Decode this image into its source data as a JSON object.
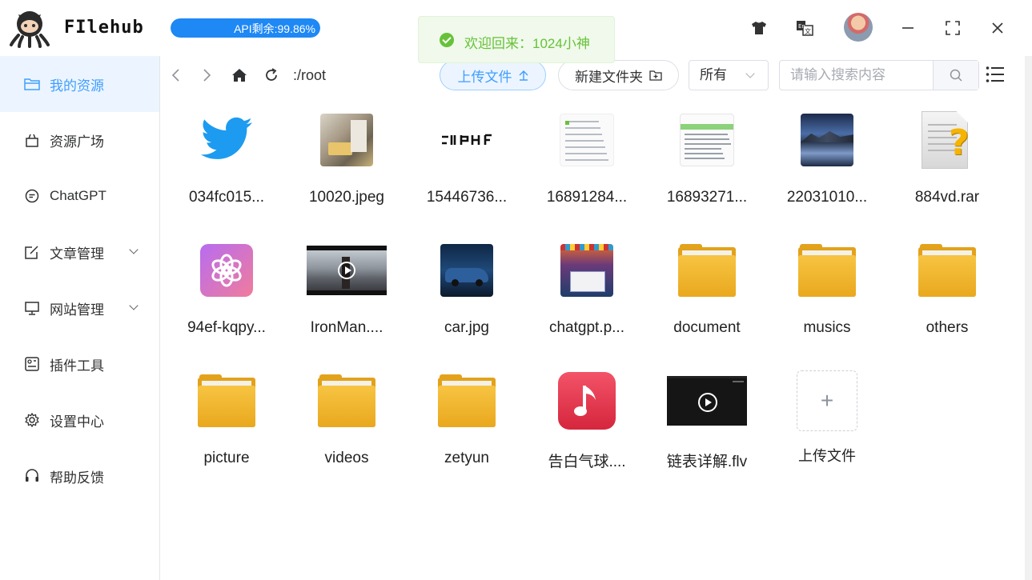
{
  "app": {
    "brand": "FIlehub"
  },
  "api": {
    "label": "API剩余:99.86%",
    "remaining_percent": 99.86
  },
  "toast": {
    "message": "欢迎回来：1024小神"
  },
  "sidebar": {
    "items": [
      {
        "label": "我的资源",
        "icon": "folder-icon",
        "active": true
      },
      {
        "label": "资源广场",
        "icon": "bag-icon"
      },
      {
        "label": "ChatGPT",
        "icon": "chat-icon"
      },
      {
        "label": "文章管理",
        "icon": "edit-icon",
        "expandable": true
      },
      {
        "label": "网站管理",
        "icon": "monitor-icon",
        "expandable": true
      },
      {
        "label": "插件工具",
        "icon": "plugin-icon"
      },
      {
        "label": "设置中心",
        "icon": "gear-icon"
      },
      {
        "label": "帮助反馈",
        "icon": "headset-icon"
      }
    ]
  },
  "toolbar": {
    "path": ":/root",
    "upload_label": "上传文件",
    "new_folder_label": "新建文件夹",
    "filter_value": "所有",
    "search_placeholder": "请输入搜索内容"
  },
  "files": [
    {
      "name": "034fc015...",
      "kind": "twitter"
    },
    {
      "name": "10020.jpeg",
      "kind": "photo-room"
    },
    {
      "name": "15446736...",
      "kind": "logo-text"
    },
    {
      "name": "16891284...",
      "kind": "doc-screenshot"
    },
    {
      "name": "16893271...",
      "kind": "doc-screenshot-green"
    },
    {
      "name": "22031010...",
      "kind": "photo-lake"
    },
    {
      "name": "884vd.rar",
      "kind": "unknown-file"
    },
    {
      "name": "94ef-kqpy...",
      "kind": "openai"
    },
    {
      "name": "IronMan....",
      "kind": "video-ironman"
    },
    {
      "name": "car.jpg",
      "kind": "photo-car"
    },
    {
      "name": "chatgpt.p...",
      "kind": "photo-desktop"
    },
    {
      "name": "document",
      "kind": "folder"
    },
    {
      "name": "musics",
      "kind": "folder"
    },
    {
      "name": "others",
      "kind": "folder"
    },
    {
      "name": "picture",
      "kind": "folder"
    },
    {
      "name": "videos",
      "kind": "folder"
    },
    {
      "name": "zetyun",
      "kind": "folder"
    },
    {
      "name": "告白气球....",
      "kind": "music"
    },
    {
      "name": "链表详解.flv",
      "kind": "video-dark"
    },
    {
      "name": "上传文件",
      "kind": "upload"
    }
  ],
  "colors": {
    "accent": "#409eff",
    "api_fill": "#1e88f5",
    "success": "#67c23a",
    "folder": "#f2b632"
  }
}
